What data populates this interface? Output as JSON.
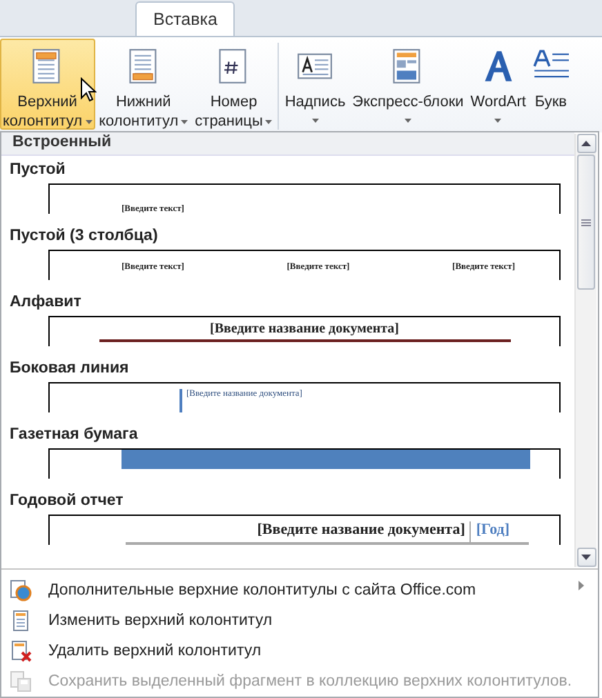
{
  "tabs": [
    {
      "label": "Вставка",
      "selected": true
    }
  ],
  "ribbon": {
    "groups": [
      {
        "buttons": [
          {
            "lines": [
              "Верхний",
              "колонтитул"
            ],
            "kind": "header",
            "dropdown": true,
            "selected": true
          },
          {
            "lines": [
              "Нижний",
              "колонтитул"
            ],
            "kind": "footer",
            "dropdown": true,
            "selected": false
          },
          {
            "lines": [
              "Номер",
              "страницы"
            ],
            "kind": "pagenum",
            "dropdown": true,
            "selected": false
          }
        ]
      },
      {
        "buttons": [
          {
            "lines": [
              "Надпись"
            ],
            "kind": "textbox",
            "dropdown": true,
            "selected": false
          },
          {
            "lines": [
              "Экспресс-блоки"
            ],
            "kind": "quickparts",
            "dropdown": true,
            "selected": false
          },
          {
            "lines": [
              "WordArt"
            ],
            "kind": "wordart",
            "dropdown": true,
            "selected": false
          },
          {
            "lines": [
              "Букв"
            ],
            "kind": "dropcap",
            "dropdown": false,
            "selected": false
          }
        ]
      }
    ]
  },
  "gallery": {
    "section": "Встроенный",
    "items": [
      {
        "title": "Пустой",
        "kind": "blank",
        "texts": [
          "[Введите текст]"
        ]
      },
      {
        "title": "Пустой (3 столбца)",
        "kind": "three",
        "texts": [
          "[Введите текст]",
          "[Введите текст]",
          "[Введите текст]"
        ]
      },
      {
        "title": "Алфавит",
        "kind": "alphabet",
        "texts": [
          "[Введите название документа]"
        ]
      },
      {
        "title": "Боковая линия",
        "kind": "sideline",
        "texts": [
          "[Введите название документа]"
        ]
      },
      {
        "title": "Газетная бумага",
        "kind": "newsprint"
      },
      {
        "title": "Годовой отчет",
        "kind": "annual",
        "texts": [
          "[Введите название документа]",
          "[Год]"
        ]
      }
    ]
  },
  "menu": [
    {
      "label": "Дополнительные верхние колонтитулы с сайта Office.com",
      "kind": "web",
      "submenu": true,
      "disabled": false
    },
    {
      "label": "Изменить верхний колонтитул",
      "kind": "edit",
      "submenu": false,
      "disabled": false
    },
    {
      "label": "Удалить верхний колонтитул",
      "kind": "remove",
      "submenu": false,
      "disabled": false
    },
    {
      "label": "Сохранить выделенный фрагмент в коллекцию верхних колонтитулов.",
      "kind": "save",
      "submenu": false,
      "disabled": true
    }
  ]
}
